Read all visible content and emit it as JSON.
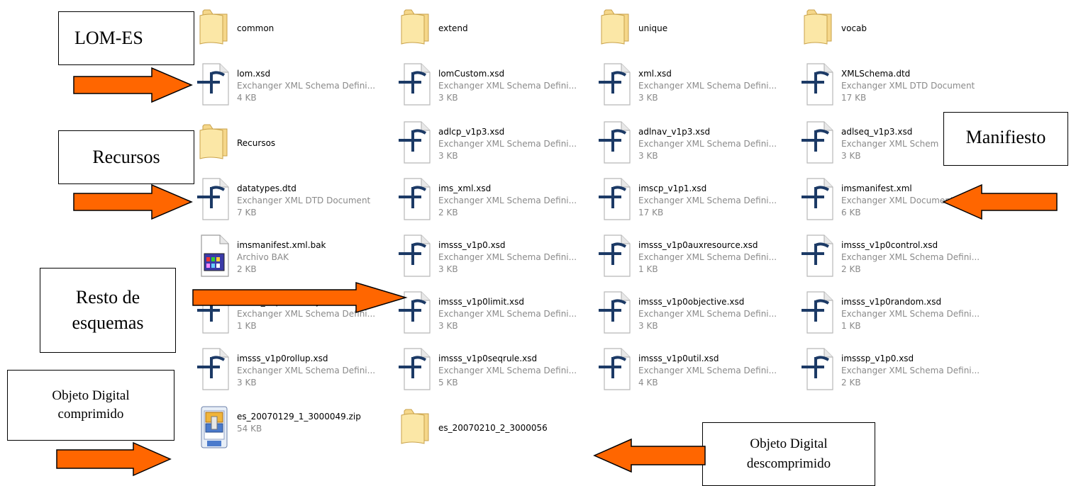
{
  "files": [
    {
      "name": "common",
      "kind": "folder"
    },
    {
      "name": "extend",
      "kind": "folder"
    },
    {
      "name": "unique",
      "kind": "folder"
    },
    {
      "name": "vocab",
      "kind": "folder"
    },
    {
      "name": "lom.xsd",
      "type": "Exchanger XML Schema Defini...",
      "size": "4 KB",
      "kind": "xml"
    },
    {
      "name": "lomCustom.xsd",
      "type": "Exchanger XML Schema Defini...",
      "size": "3 KB",
      "kind": "xml"
    },
    {
      "name": "xml.xsd",
      "type": "Exchanger XML Schema Defini...",
      "size": "3 KB",
      "kind": "xml"
    },
    {
      "name": "XMLSchema.dtd",
      "type": "Exchanger XML DTD Document",
      "size": "17 KB",
      "kind": "xml"
    },
    {
      "name": "Recursos",
      "kind": "folder"
    },
    {
      "name": "adlcp_v1p3.xsd",
      "type": "Exchanger XML Schema Defini...",
      "size": "3 KB",
      "kind": "xml"
    },
    {
      "name": "adlnav_v1p3.xsd",
      "type": "Exchanger XML Schema Defini...",
      "size": "3 KB",
      "kind": "xml"
    },
    {
      "name": "adlseq_v1p3.xsd",
      "type": "Exchanger XML Schem",
      "size": "3 KB",
      "kind": "xml"
    },
    {
      "name": "datatypes.dtd",
      "type": "Exchanger XML DTD Document",
      "size": "7 KB",
      "kind": "xml"
    },
    {
      "name": "ims_xml.xsd",
      "type": "Exchanger XML Schema Defini...",
      "size": "2 KB",
      "kind": "xml"
    },
    {
      "name": "imscp_v1p1.xsd",
      "type": "Exchanger XML Schema Defini...",
      "size": "17 KB",
      "kind": "xml"
    },
    {
      "name": "imsmanifest.xml",
      "type": "Exchanger XML Document",
      "size": "6 KB",
      "kind": "xml"
    },
    {
      "name": "imsmanifest.xml.bak",
      "type": "Archivo BAK",
      "size": "2 KB",
      "kind": "bak"
    },
    {
      "name": "imsss_v1p0.xsd",
      "type": "Exchanger XML Schema Defini...",
      "size": "3 KB",
      "kind": "xml"
    },
    {
      "name": "imsss_v1p0auxresource.xsd",
      "type": "Exchanger XML Schema Defini...",
      "size": "1 KB",
      "kind": "xml"
    },
    {
      "name": "imsss_v1p0control.xsd",
      "type": "Exchanger XML Schema Defini...",
      "size": "2 KB",
      "kind": "xml"
    },
    {
      "name": "imsss_v1p0delivery.xsd",
      "type": "Exchanger XML Schema Defini...",
      "size": "1 KB",
      "kind": "xml"
    },
    {
      "name": "imsss_v1p0limit.xsd",
      "type": "Exchanger XML Schema Defini...",
      "size": "3 KB",
      "kind": "xml"
    },
    {
      "name": "imsss_v1p0objective.xsd",
      "type": "Exchanger XML Schema Defini...",
      "size": "3 KB",
      "kind": "xml"
    },
    {
      "name": "imsss_v1p0random.xsd",
      "type": "Exchanger XML Schema Defini...",
      "size": "1 KB",
      "kind": "xml"
    },
    {
      "name": "imsss_v1p0rollup.xsd",
      "type": "Exchanger XML Schema Defini...",
      "size": "3 KB",
      "kind": "xml"
    },
    {
      "name": "imsss_v1p0seqrule.xsd",
      "type": "Exchanger XML Schema Defini...",
      "size": "5 KB",
      "kind": "xml"
    },
    {
      "name": "imsss_v1p0util.xsd",
      "type": "Exchanger XML Schema Defini...",
      "size": "4 KB",
      "kind": "xml"
    },
    {
      "name": "imsssp_v1p0.xsd",
      "type": "Exchanger XML Schema Defini...",
      "size": "2 KB",
      "kind": "xml"
    },
    {
      "name": "es_20070129_1_3000049.zip",
      "size": "54 KB",
      "kind": "zip"
    },
    {
      "name": "es_20070210_2_3000056",
      "kind": "folder"
    }
  ],
  "callouts": {
    "lom": "LOM-ES",
    "recursos": "Recursos",
    "manifiesto": "Manifiesto",
    "resto_line1": "Resto de",
    "resto_line2": "esquemas",
    "obj_comp_line1": "Objeto Digital",
    "obj_comp_line2": "comprimido",
    "obj_desc_line1": "Objeto Digital",
    "obj_desc_line2": "descomprimido"
  },
  "colors": {
    "arrow": "#ff6600",
    "folder": "#f5d78a",
    "name": "#000000",
    "meta": "#8a8a8a"
  }
}
